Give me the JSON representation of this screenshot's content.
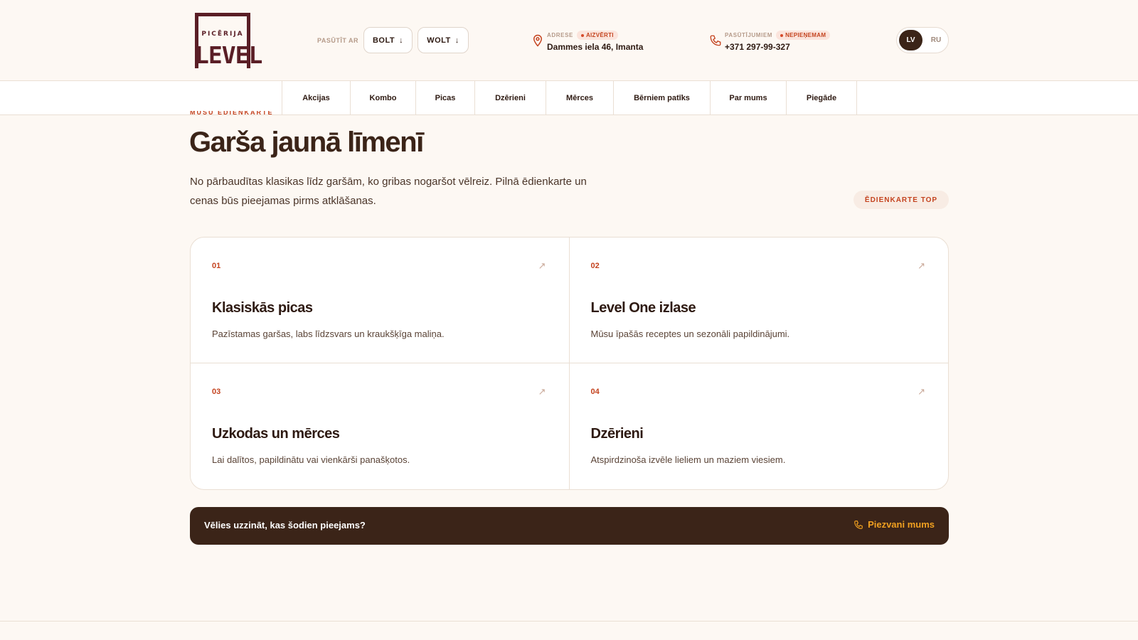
{
  "header": {
    "logo": {
      "top_text": "PICĒRIJA",
      "main_text": "LEVEL"
    },
    "order_label": "PASŪTĪT AR",
    "order_buttons": [
      {
        "label": "BOLT",
        "arrow": "↓"
      },
      {
        "label": "WOLT",
        "arrow": "↓"
      }
    ],
    "address": {
      "label": "ADRESE",
      "status": "AIZVĒRTI",
      "value": "Dammes iela 46, Imanta"
    },
    "orders": {
      "label": "PASŪTĪJUMIEM",
      "status": "NEPIEŅEMAM",
      "value": "+371 297-99-327"
    },
    "languages": {
      "active": "LV",
      "other": "RU"
    }
  },
  "nav": {
    "items": [
      "Akcijas",
      "Kombo",
      "Picas",
      "Dzērieni",
      "Mērces",
      "Bērniem patīks",
      "Par mums",
      "Piegāde"
    ]
  },
  "main": {
    "eyebrow": "MŪSU ĒDIENKARTE",
    "title": "Garša jaunā līmenī",
    "description": "No pārbaudītas klasikas līdz garšām, ko gribas nogaršot vēlreiz. Pilnā ēdienkarte un cenas būs pieejamas pirms atklāšanas.",
    "menu_top_label": "ĒDIENKARTE TOP",
    "cards": [
      {
        "num": "01",
        "title": "Klasiskās picas",
        "desc": "Pazīstamas garšas, labs līdzsvars un kraukšķīga maliņa.",
        "arrow": "↗"
      },
      {
        "num": "02",
        "title": "Level One izlase",
        "desc": "Mūsu īpašās receptes un sezonāli papildinājumi.",
        "arrow": "↗"
      },
      {
        "num": "03",
        "title": "Uzkodas un mērces",
        "desc": "Lai dalītos, papildinātu vai vienkārši panašķotos.",
        "arrow": "↗"
      },
      {
        "num": "04",
        "title": "Dzērieni",
        "desc": "Atspirdzinoša izvēle lieliem un maziem viesiem.",
        "arrow": "↗"
      }
    ],
    "cta": {
      "text": "Vēlies uzzināt, kas šodien pieejams?",
      "call_label": "Piezvani mums"
    }
  },
  "colors": {
    "accent": "#c4431f",
    "dark": "#3b2418",
    "cta_link": "#f0a020",
    "logo": "#5a1e26"
  }
}
